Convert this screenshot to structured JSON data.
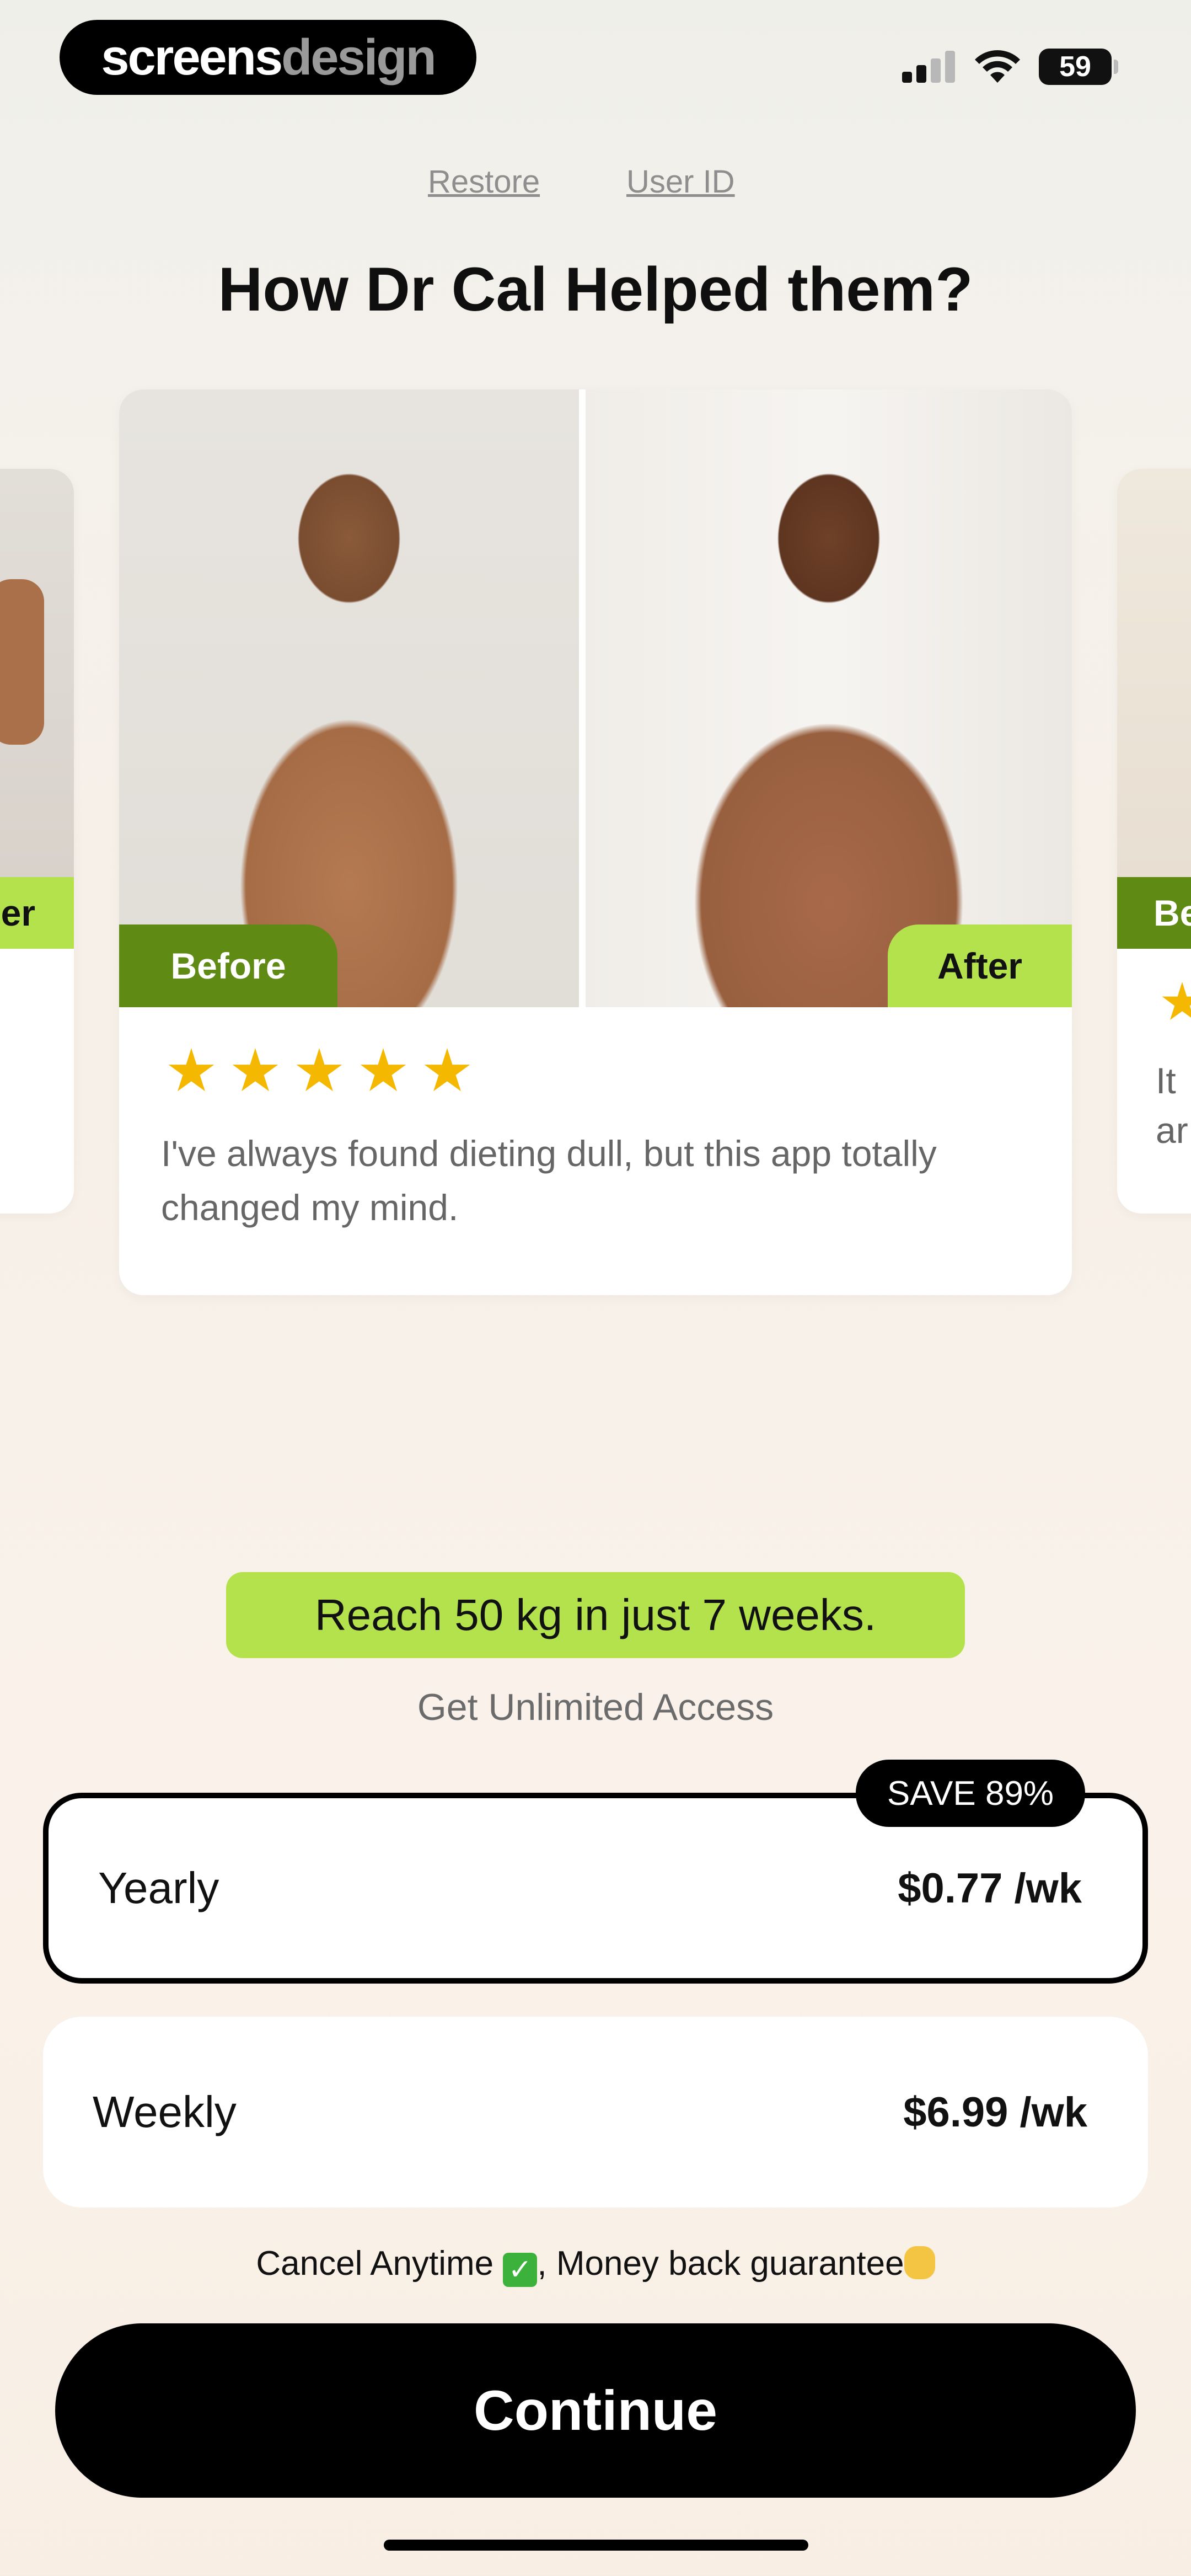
{
  "brand": {
    "part1": "screens",
    "part2": "design"
  },
  "status": {
    "battery": "59"
  },
  "links": {
    "restore": "Restore",
    "user_id": "User ID"
  },
  "title": "How Dr Cal Helped them?",
  "carousel": {
    "main": {
      "before_label": "Before",
      "after_label": "After",
      "rating": 5,
      "review": "I've always found dieting dull, but this app totally changed my mind."
    },
    "prev_peek": {
      "label": "er"
    },
    "next_peek": {
      "label": "Be",
      "text_line1": "It",
      "text_line2": "ar"
    }
  },
  "promo": "Reach 50 kg in just 7 weeks.",
  "access": "Get Unlimited Access",
  "plans": [
    {
      "name": "Yearly",
      "price": "$0.77 /wk",
      "badge": "SAVE 89%",
      "selected": true
    },
    {
      "name": "Weekly",
      "price": "$6.99 /wk",
      "selected": false
    }
  ],
  "guarantee": {
    "part1": "Cancel Anytime ",
    "part2": ", Money back guarantee"
  },
  "cta": "Continue",
  "colors": {
    "accent_green": "#b4e24d",
    "dark_green": "#5f8a14",
    "star": "#f5b800"
  }
}
